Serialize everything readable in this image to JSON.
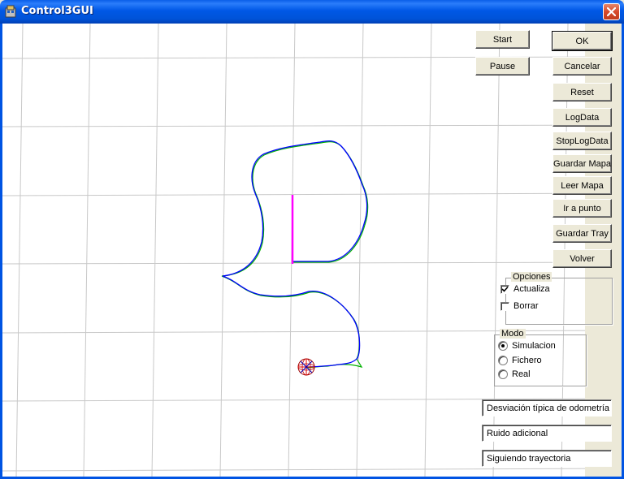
{
  "window": {
    "title": "Control3GUI"
  },
  "icons": {
    "app": "app-icon",
    "close": "close-icon"
  },
  "colors": {
    "path_blue": "#0000ff",
    "path_green": "#00b000",
    "path_magenta": "#ff00ff",
    "robot_red": "#e00000",
    "grid": "#c8c8c8"
  },
  "controls": {
    "start": "Start",
    "pause": "Pause",
    "ok": "OK",
    "cancelar": "Cancelar",
    "reset": "Reset",
    "logdata": "LogData",
    "stoplogdata": "StopLogData",
    "guardar_mapa": "Guardar Mapa",
    "leer_mapa": "Leer Mapa",
    "ir_a_punto": "Ir a punto",
    "guardar_tray": "Guardar Tray",
    "volver": "Volver"
  },
  "opciones": {
    "title": "Opciones",
    "actualiza": {
      "label": "Actualiza",
      "checked": true
    },
    "borrar": {
      "label": "Borrar",
      "checked": false
    }
  },
  "modo": {
    "title": "Modo",
    "options": [
      {
        "label": "Simulacion",
        "selected": true
      },
      {
        "label": "Fichero",
        "selected": false
      },
      {
        "label": "Real",
        "selected": false
      }
    ]
  },
  "status": {
    "odometry": "Desviación típica de odometría",
    "noise": "Ruido adicional",
    "state": "Siguiendo trayectoria"
  }
}
